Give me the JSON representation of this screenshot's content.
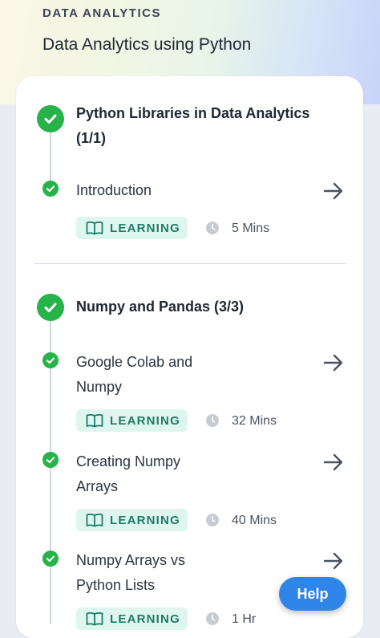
{
  "header": {
    "eyebrow": "DATA ANALYTICS",
    "title": "Data Analytics using Python"
  },
  "sections": [
    {
      "title": "Python Libraries in Data Analytics (1/1)",
      "lessons": [
        {
          "title": "Introduction",
          "badge": "LEARNING",
          "duration": "5 Mins"
        }
      ]
    },
    {
      "title": "Numpy and Pandas (3/3)",
      "lessons": [
        {
          "title": "Google Colab and Numpy",
          "badge": "LEARNING",
          "duration": "32 Mins"
        },
        {
          "title": "Creating Numpy Arrays",
          "badge": "LEARNING",
          "duration": "40 Mins"
        },
        {
          "title": "Numpy Arrays vs Python Lists",
          "badge": "LEARNING",
          "duration": "1 Hr"
        }
      ]
    }
  ],
  "help": {
    "label": "Help"
  },
  "colors": {
    "check": "#27b24a",
    "badge_bg": "#dff6ee",
    "badge_text": "#1e7b67",
    "help_button": "#2f86e8"
  }
}
